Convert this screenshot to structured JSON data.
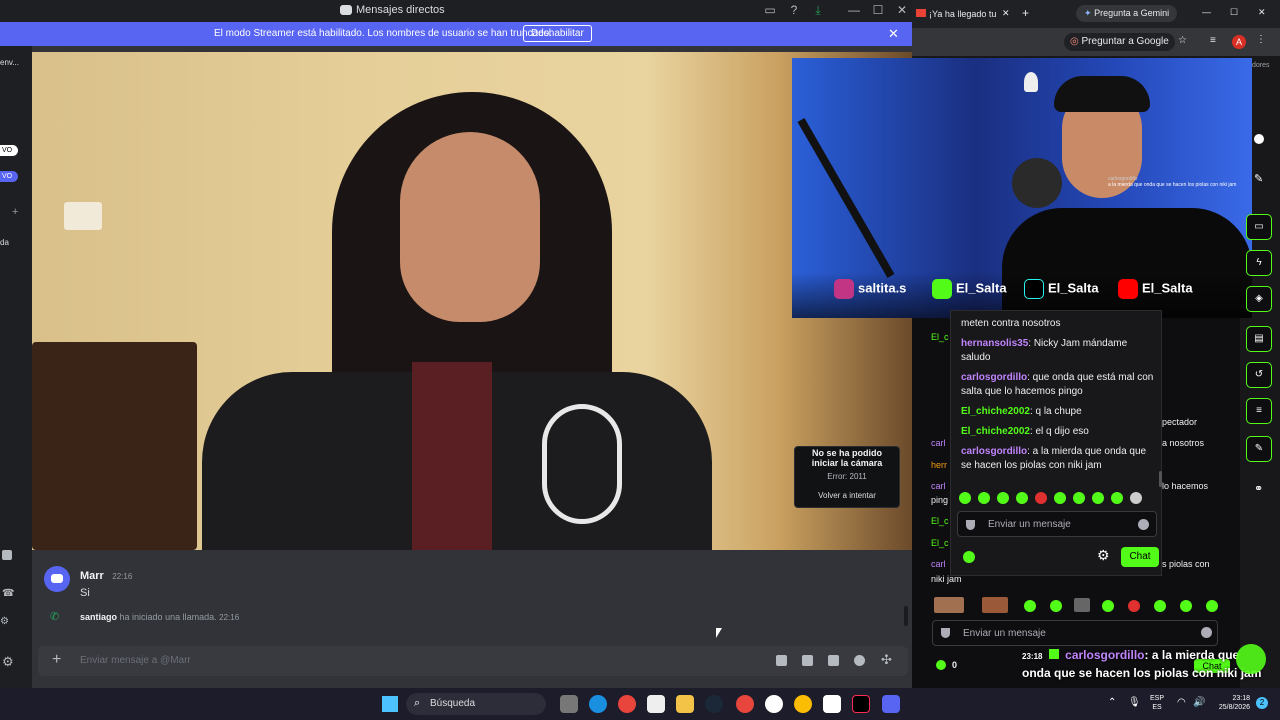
{
  "discord": {
    "window_title": "Mensajes directos",
    "streamer_banner": "El modo Streamer está habilitado. Los nombres de usuario se han truncado.",
    "disable_button": "Deshabilitar",
    "left_rail": {
      "top_label": "env...",
      "badge1": "VO",
      "badge2": "VO",
      "bottom_label": "da"
    },
    "camera_error": {
      "title_line1": "No se ha podido",
      "title_line2": "iniciar la cámara",
      "error": "Error: 2011",
      "retry": "Volver a intentar"
    },
    "messages": [
      {
        "author": "Marr",
        "time": "22:16",
        "text": "Si"
      }
    ],
    "call_notice": {
      "user": "santiago",
      "text": "ha iniciado una llamada.",
      "time": "22:16"
    },
    "input_placeholder": "Enviar mensaje a @Marr"
  },
  "browser": {
    "tab_title": "¡Ya ha llegado tu",
    "gemini_button": "Pregunta a Gemini",
    "ask_google": "Preguntar a Google",
    "bookmarks_label": "dores",
    "avatar_letter": "A"
  },
  "stream": {
    "socials": [
      {
        "handle": "saltita.s",
        "color": "#c13584"
      },
      {
        "handle": "El_Salta",
        "color": "#53fc18"
      },
      {
        "handle": "El_Salta",
        "color": "#000000"
      },
      {
        "handle": "El_Salta",
        "color": "#ff0000"
      }
    ],
    "overlay_user": "carlosgordillo",
    "overlay_text": "a la mierda que onda que se hacen los piolas con niki jam"
  },
  "kick_popup": {
    "messages": [
      {
        "name": "",
        "text": "meten contra nosotros",
        "color": "none"
      },
      {
        "name": "hernansolis35",
        "text": ": Nicky Jam mándame saludo",
        "color": "purple"
      },
      {
        "name": "carlosgordillo",
        "text": ": que onda que está mal con salta que lo hacemos pingo",
        "color": "purple"
      },
      {
        "name": "El_chiche2002",
        "text": ": q la chupe",
        "color": "green"
      },
      {
        "name": "El_chiche2002",
        "text": ": el q dijo eso",
        "color": "green"
      },
      {
        "name": "carlosgordillo",
        "text": ": a la mierda que onda que se hacen los piolas con niki jam",
        "color": "purple"
      }
    ],
    "input_placeholder": "Enviar un mensaje",
    "chat_button": "Chat"
  },
  "kick_background": {
    "fragments": [
      "pectador",
      "a nosotros",
      "lo hacemos",
      "s piolas con",
      "niki jam"
    ],
    "left_fragments": [
      "El_c",
      "carl",
      "herr",
      "carl",
      "ping",
      "El_c",
      "El_c",
      "carl"
    ],
    "input_placeholder": "Enviar un mensaje",
    "viewer_count": "0",
    "chat_button": "Chat"
  },
  "caption": {
    "time": "23:18",
    "user": "carlosgordillo",
    "text_line1": ": a la mierda que",
    "text_line2": "onda que se hacen los piolas con niki jam"
  },
  "taskbar": {
    "search_label": "Búsqueda",
    "lang_top": "ESP",
    "lang_bottom": "ES",
    "time": "23:18",
    "date": "25/8/2026",
    "notification_count": "2"
  }
}
